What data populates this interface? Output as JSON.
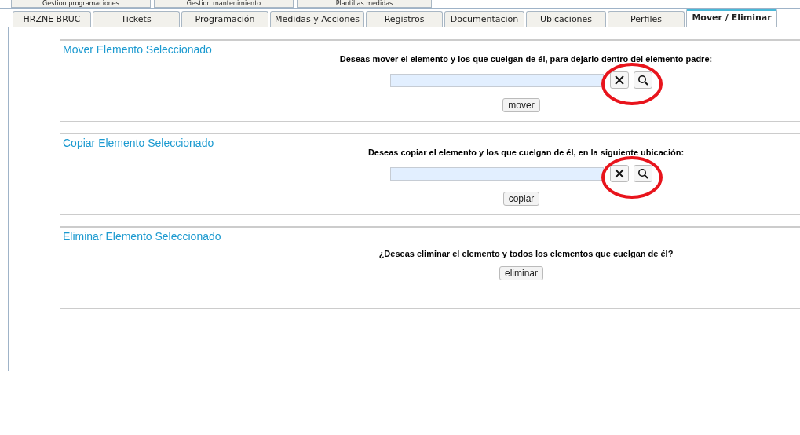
{
  "top_tabs": [
    {
      "label": "Gestion programaciones"
    },
    {
      "label": "Gestion mantenimiento"
    },
    {
      "label": "Plantillas medidas"
    }
  ],
  "tabs": [
    {
      "label": "HRZNE BRUC",
      "selected": false
    },
    {
      "label": "Tickets",
      "selected": false
    },
    {
      "label": "Programación",
      "selected": false
    },
    {
      "label": "Medidas y Acciones",
      "selected": false
    },
    {
      "label": "Registros",
      "selected": false
    },
    {
      "label": "Documentacion",
      "selected": false
    },
    {
      "label": "Ubicaciones",
      "selected": false
    },
    {
      "label": "Perfiles",
      "selected": false
    },
    {
      "label": "Mover / Eliminar",
      "selected": true
    }
  ],
  "panels": [
    {
      "kind": "search",
      "title": "Mover Elemento Seleccionado",
      "question": "Deseas mover el elemento y los que cuelgan de él, para dejarlo dentro del elemento padre:",
      "button": "mover",
      "circled": true
    },
    {
      "kind": "search",
      "title": "Copiar Elemento Seleccionado",
      "question": "Deseas copiar el elemento y los que cuelgan de él, en la siguiente ubicación:",
      "button": "copiar",
      "circled": true
    },
    {
      "kind": "plain",
      "title": "Eliminar Elemento Seleccionado",
      "question": "¿Deseas eliminar el elemento y todos los elementos que cuelgan de él?",
      "button": "eliminar",
      "circled": false
    }
  ]
}
